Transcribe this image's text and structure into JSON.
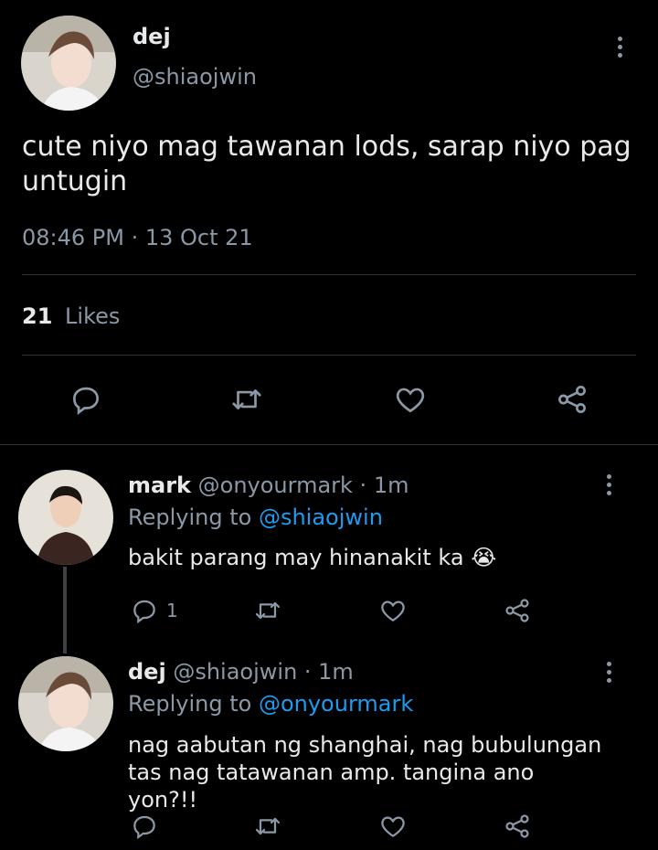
{
  "main_tweet": {
    "display_name": "dej",
    "handle": "@shiaojwin",
    "text": "cute niyo mag tawanan lods, sarap niyo pag untugin",
    "timestamp": "08:46 PM · 13 Oct 21",
    "likes_count": "21",
    "likes_label": "Likes"
  },
  "replies": [
    {
      "display_name": "mark",
      "meta": "@onyourmark · 1m",
      "replying_prefix": "Replying to",
      "replying_handle": "@shiaojwin",
      "text": "bakit parang may hinanakit ka",
      "emoji": "😭",
      "reply_count": "1"
    },
    {
      "display_name": "dej",
      "meta": "@shiaojwin · 1m",
      "replying_prefix": "Replying to",
      "replying_handle": "@onyourmark",
      "text": "nag aabutan ng shanghai, nag bubulungan tas nag tatawanan amp. tangina ano yon?!!"
    }
  ],
  "colors": {
    "background": "#000000",
    "text": "#e7e9ea",
    "secondary": "#8b98a5",
    "link": "#1d9bf0",
    "divider": "#2f3336"
  }
}
